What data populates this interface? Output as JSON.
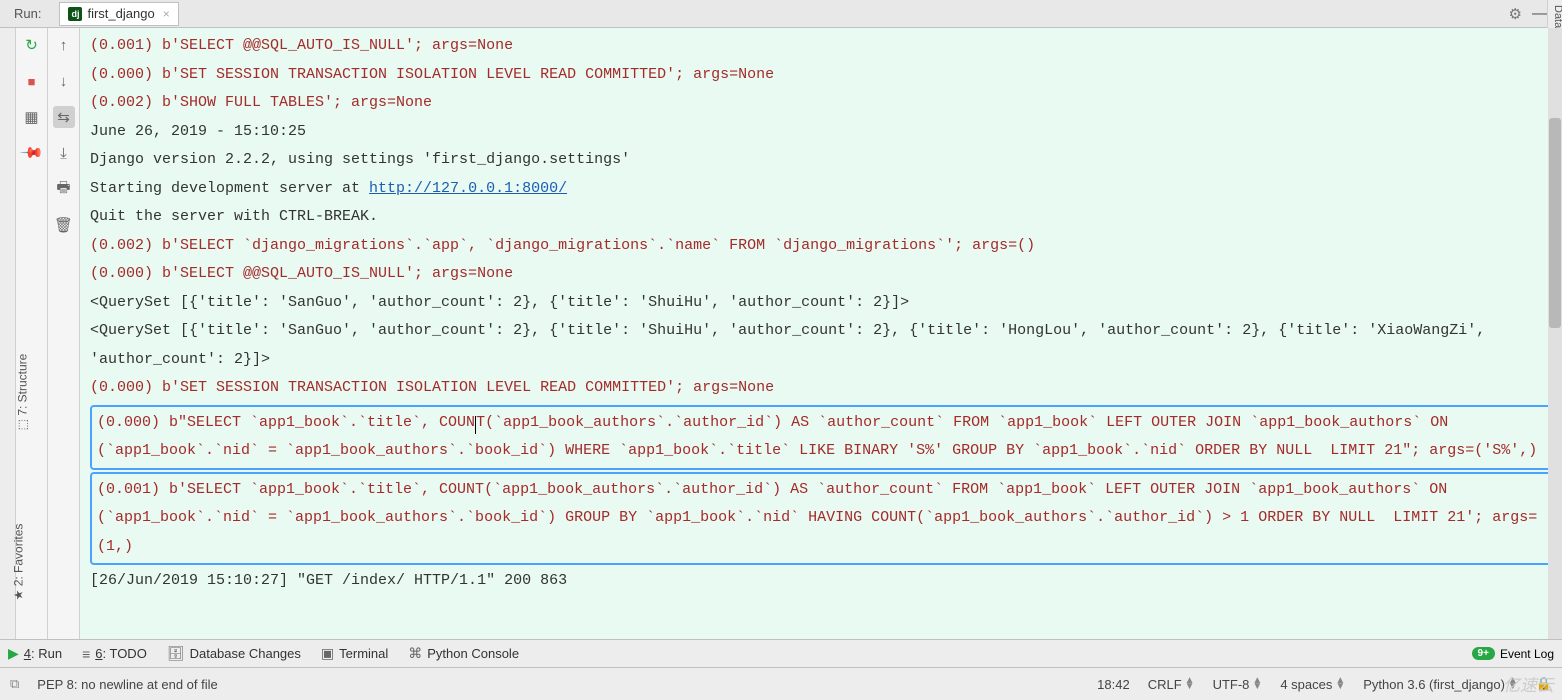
{
  "header": {
    "run_label": "Run:",
    "tab_label": "first_django"
  },
  "right_label": "Database",
  "sides": {
    "favorites": "★ 2: Favorites",
    "structure": "⬚ 7: Structure"
  },
  "console": {
    "l1": "(0.001) b'SELECT @@SQL_AUTO_IS_NULL'; args=None",
    "l2": "(0.000) b'SET SESSION TRANSACTION ISOLATION LEVEL READ COMMITTED'; args=None",
    "l3": "(0.002) b'SHOW FULL TABLES'; args=None",
    "l4": "June 26, 2019 - 15:10:25",
    "l5_pre": "Django version 2.2.2, using settings 'first_django.settings'",
    "l6_pre": "Starting development server at ",
    "l6_link": "http://127.0.0.1:8000/",
    "l7": "Quit the server with CTRL-BREAK.",
    "l8": "(0.002) b'SELECT `django_migrations`.`app`, `django_migrations`.`name` FROM `django_migrations`'; args=()",
    "l9": "(0.000) b'SELECT @@SQL_AUTO_IS_NULL'; args=None",
    "l10": "<QuerySet [{'title': 'SanGuo', 'author_count': 2}, {'title': 'ShuiHu', 'author_count': 2}]>",
    "l11": "<QuerySet [{'title': 'SanGuo', 'author_count': 2}, {'title': 'ShuiHu', 'author_count': 2}, {'title': 'HongLou', 'author_count': 2}, {'title': 'XiaoWangZi', 'author_count': 2}]>",
    "l12": "(0.000) b'SET SESSION TRANSACTION ISOLATION LEVEL READ COMMITTED'; args=None",
    "box1_a": "(0.000) b\"SELECT `app1_book`.`title`, COUN",
    "box1_b": "T(`app1_book_authors`.`author_id`) AS `author_count` FROM `app1_book` LEFT OUTER JOIN `app1_book_authors` ON (`app1_book`.`nid` = `app1_book_authors`.`book_id`) WHERE `app1_book`.`title` LIKE BINARY 'S%' GROUP BY `app1_book`.`nid` ORDER BY NULL  LIMIT 21\"; args=('S%',)",
    "box2": "(0.001) b'SELECT `app1_book`.`title`, COUNT(`app1_book_authors`.`author_id`) AS `author_count` FROM `app1_book` LEFT OUTER JOIN `app1_book_authors` ON (`app1_book`.`nid` = `app1_book_authors`.`book_id`) GROUP BY `app1_book`.`nid` HAVING COUNT(`app1_book_authors`.`author_id`) > 1 ORDER BY NULL  LIMIT 21'; args=(1,)",
    "l_last": "[26/Jun/2019 15:10:27] \"GET /index/ HTTP/1.1\" 200 863"
  },
  "bottom_tabs": {
    "run": "4: Run",
    "todo": "6: TODO",
    "db": "Database Changes",
    "terminal": "Terminal",
    "python": "Python Console",
    "event_log": "Event Log"
  },
  "status": {
    "msg": "PEP 8: no newline at end of file",
    "time": "18:42",
    "crlf": "CRLF",
    "encoding": "UTF-8",
    "spaces": "4 spaces",
    "interp": "Python 3.6 (first_django)"
  },
  "watermark": "亿速云"
}
